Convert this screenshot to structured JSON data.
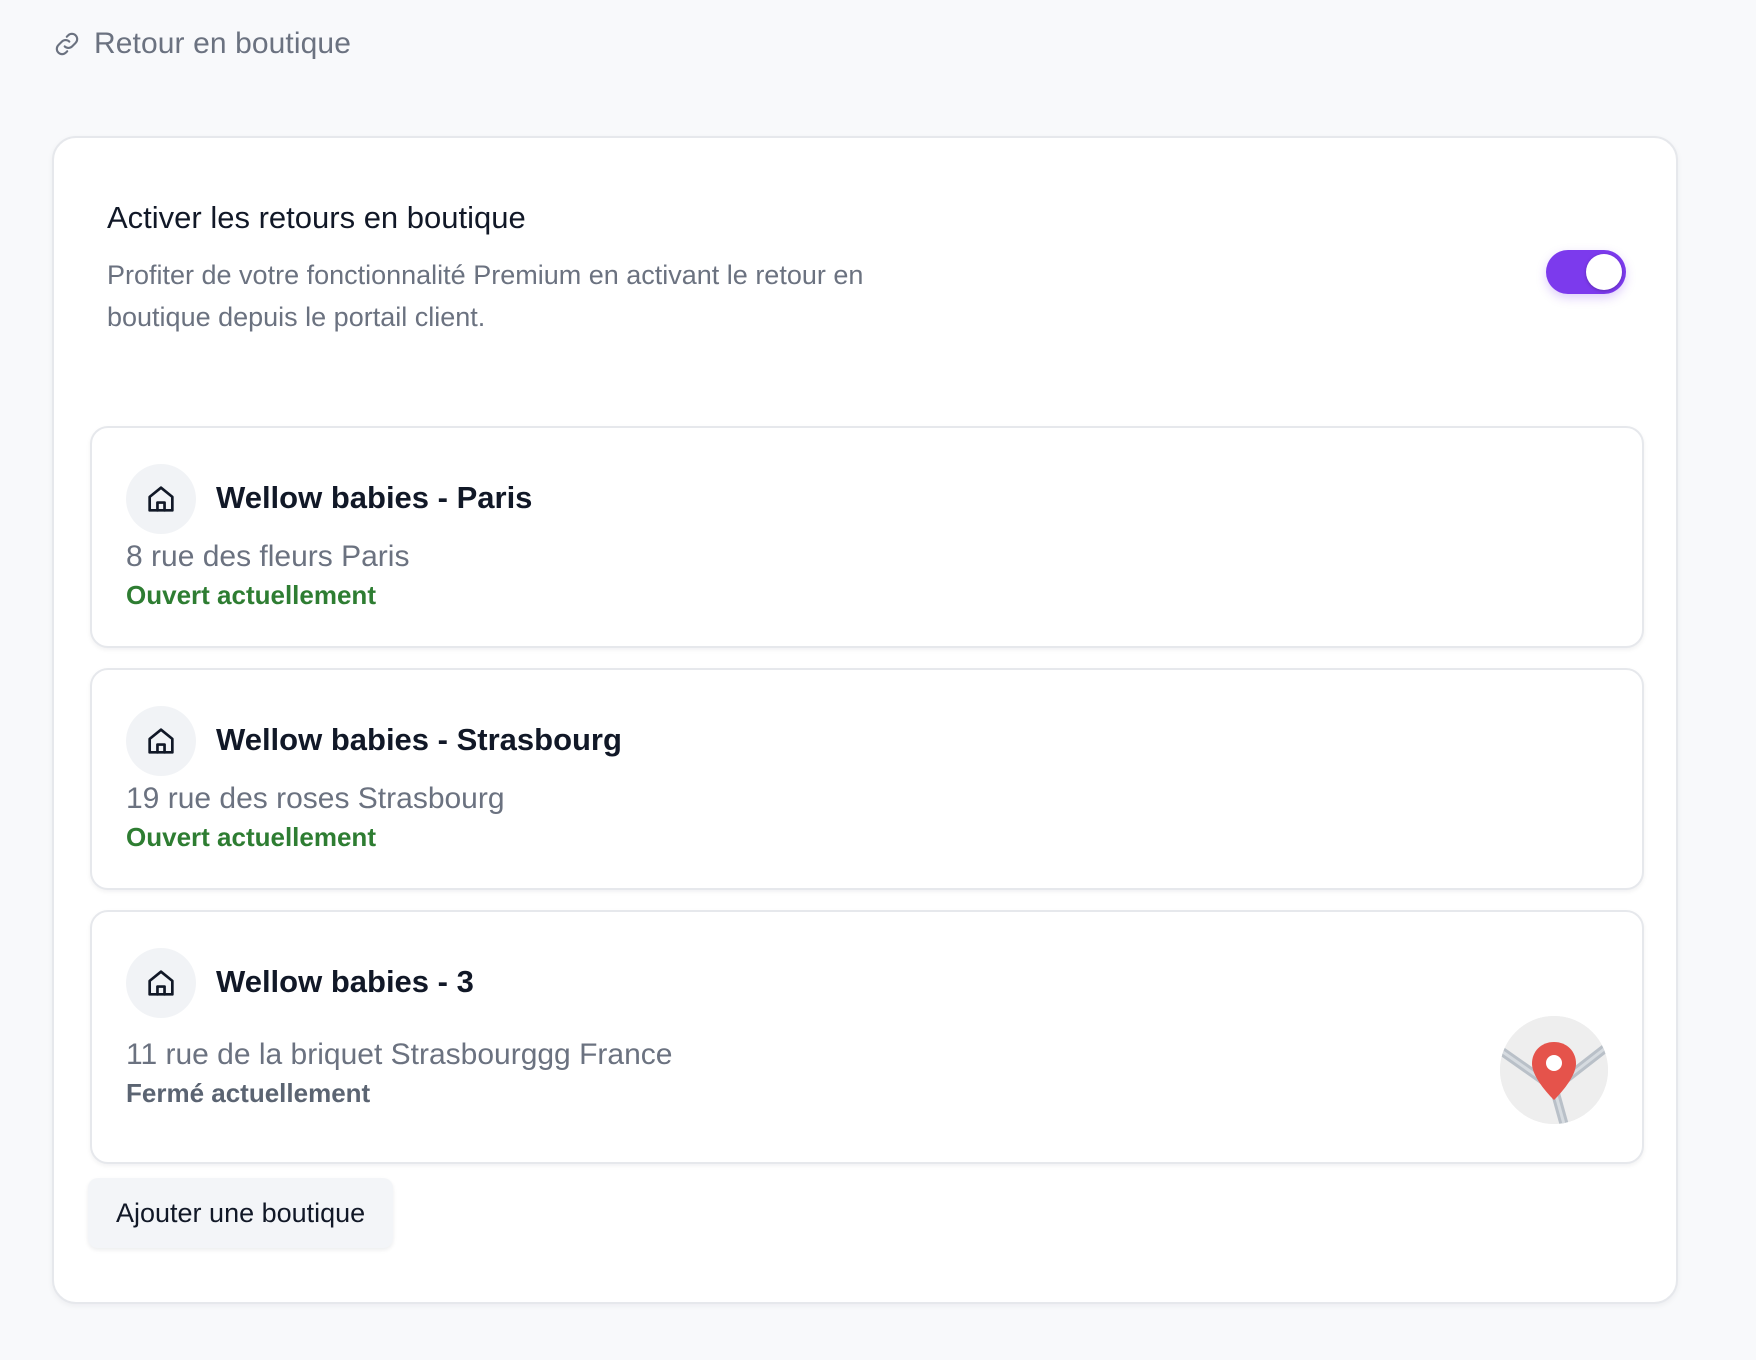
{
  "section": {
    "title": "Retour en boutique",
    "icon": "link-icon"
  },
  "feature": {
    "title": "Activer les retours en boutique",
    "description": "Profiter de votre fonctionnalité Premium en activant le retour en boutique depuis le portail client.",
    "toggle_on": true,
    "accent_color": "#7c3aed"
  },
  "stores": [
    {
      "name": "Wellow babies - Paris",
      "address": "8 rue des fleurs Paris",
      "status": "Ouvert actuellement",
      "status_type": "open",
      "icon": "home-icon"
    },
    {
      "name": "Wellow babies - Strasbourg",
      "address": "19 rue des roses Strasbourg",
      "status": "Ouvert actuellement",
      "status_type": "open",
      "icon": "home-icon"
    },
    {
      "name": "Wellow babies - 3",
      "address": "11 rue de la briquet Strasbourggg France",
      "status": "Fermé actuellement",
      "status_type": "closed",
      "icon": "home-icon",
      "has_map": true
    }
  ],
  "actions": {
    "add_store_label": "Ajouter une boutique"
  },
  "colors": {
    "open": "#2e7d32",
    "closed": "#5b6472",
    "pin": "#e5534b"
  }
}
